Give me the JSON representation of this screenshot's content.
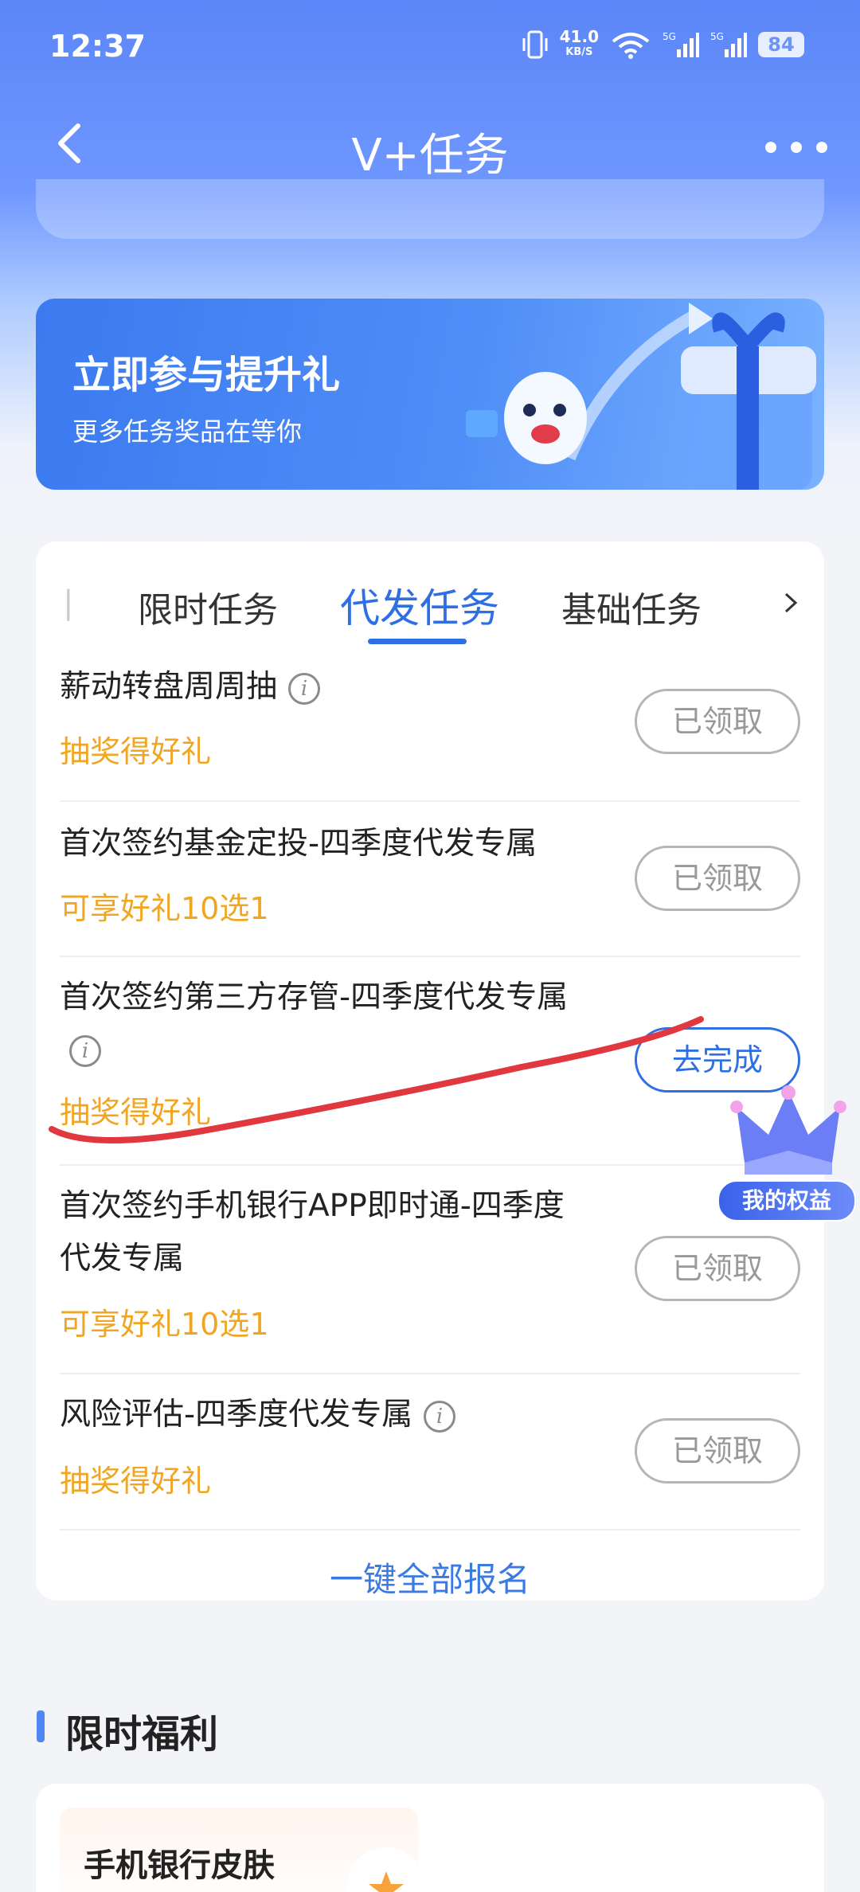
{
  "status_bar": {
    "time": "12:37",
    "net_speed": "41.0",
    "net_unit": "KB/S",
    "battery": "84"
  },
  "header": {
    "title": "V+任务"
  },
  "banner": {
    "title": "立即参与提升礼",
    "subtitle": "更多任务奖品在等你"
  },
  "tabs": {
    "items": [
      {
        "label": "限时任务"
      },
      {
        "label": "代发任务",
        "active": true
      },
      {
        "label": "基础任务"
      }
    ]
  },
  "tasks": [
    {
      "name": "薪动转盘周周抽",
      "reward": "抽奖得好礼",
      "button": "已领取",
      "has_info": true
    },
    {
      "name": "首次签约基金定投-四季度代发专属",
      "reward": "可享好礼10选1",
      "button": "已领取",
      "has_info": false
    },
    {
      "name": "首次签约第三方存管-四季度代发专属",
      "reward": "抽奖得好礼",
      "button": "去完成",
      "has_info": true
    },
    {
      "name_line1": "首次签约手机银行APP即时通-四季度",
      "name_line2": "代发专属",
      "reward": "可享好礼10选1",
      "button": "已领取",
      "has_info": false
    },
    {
      "name": "风险评估-四季度代发专属",
      "reward": "抽奖得好礼",
      "button": "已领取",
      "has_info": true
    }
  ],
  "signup_all": "一键全部报名",
  "float_badge": "我的权益",
  "section": {
    "title": "限时福利",
    "benefit_name": "手机银行皮肤"
  },
  "colors": {
    "primary": "#2f6fe4",
    "reward": "#f0a623",
    "scribble": "#e0383e"
  }
}
